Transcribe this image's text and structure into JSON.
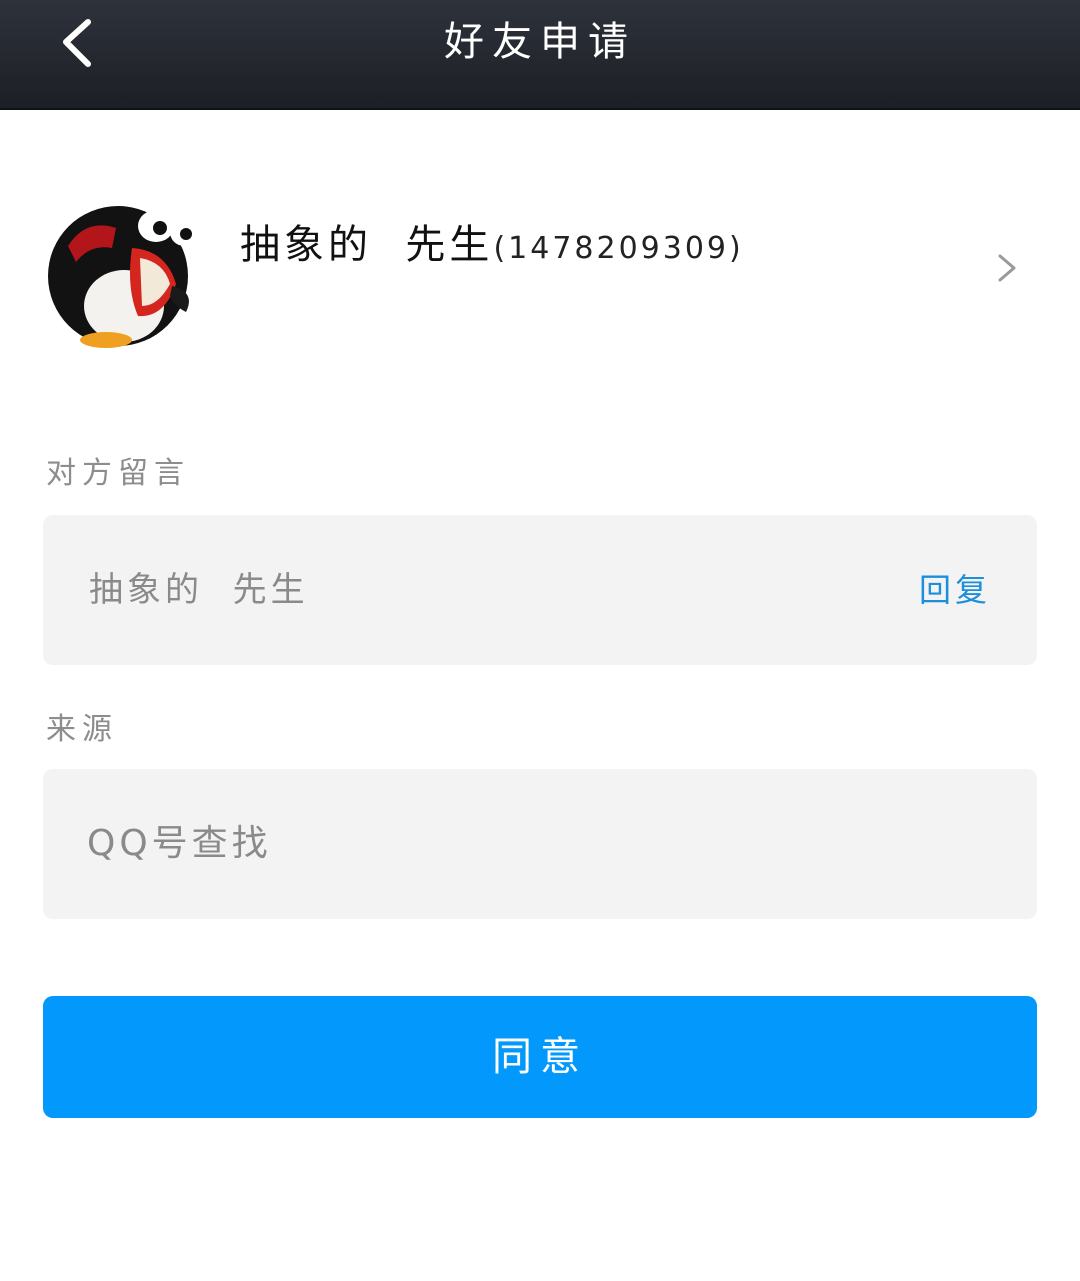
{
  "nav": {
    "title": "好友申请",
    "back_icon": "chevron-left-icon"
  },
  "profile": {
    "name": "抽象的  先生",
    "id": "(1478209309)",
    "avatar": "penguin-avatar",
    "chevron_icon": "chevron-right-icon"
  },
  "message": {
    "label": "对方留言",
    "text": "抽象的  先生",
    "reply_label": "回复"
  },
  "source": {
    "label": "来源",
    "text": "QQ号查找"
  },
  "actions": {
    "agree_label": "同意"
  },
  "colors": {
    "nav_bar": "#23262d",
    "accent_blue": "#0398fb",
    "reply_link": "#1c8fdc",
    "box_background": "#f3f3f3",
    "label_grey": "#8d8d8d"
  }
}
